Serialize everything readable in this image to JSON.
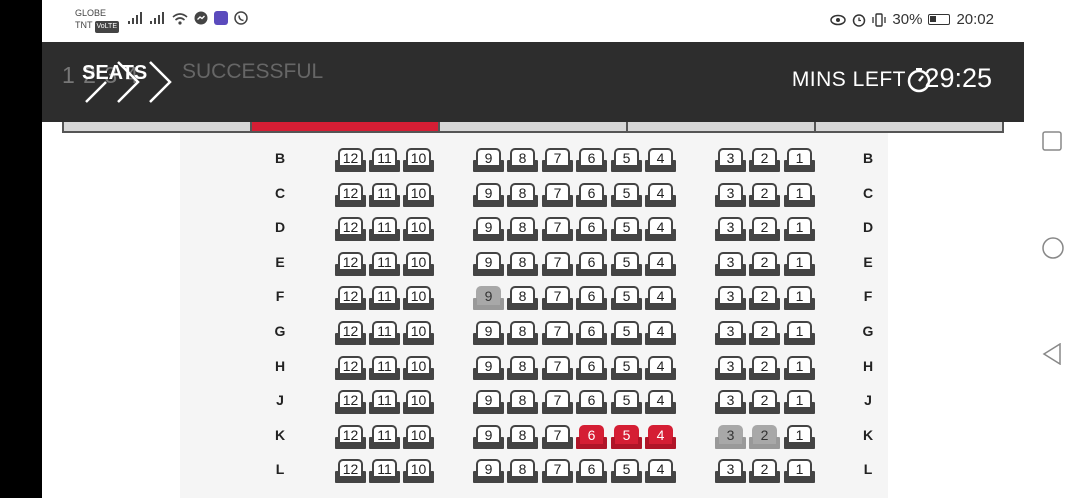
{
  "status_bar": {
    "carrier_line1": "GLOBE",
    "carrier_line2": "TNT",
    "volte": "VoLTE",
    "battery_percent": "30%",
    "battery_level": 0.3,
    "time": "20:02"
  },
  "header": {
    "steps": "1  2  3  4",
    "title": "SEATS",
    "ghost_text": "SUCCESSFUL",
    "timer_label": "MINS LEFT",
    "timer_value": "29:25"
  },
  "seat_columns": [
    "12",
    "11",
    "10",
    "9",
    "8",
    "7",
    "6",
    "5",
    "4",
    "3",
    "2",
    "1"
  ],
  "rows": [
    {
      "label": "B",
      "selected": [],
      "taken": []
    },
    {
      "label": "C",
      "selected": [],
      "taken": []
    },
    {
      "label": "D",
      "selected": [],
      "taken": []
    },
    {
      "label": "E",
      "selected": [],
      "taken": []
    },
    {
      "label": "F",
      "selected": [],
      "taken": [
        "9"
      ]
    },
    {
      "label": "G",
      "selected": [],
      "taken": []
    },
    {
      "label": "H",
      "selected": [],
      "taken": []
    },
    {
      "label": "J",
      "selected": [],
      "taken": []
    },
    {
      "label": "K",
      "selected": [
        "6",
        "5",
        "4"
      ],
      "taken": [
        "3",
        "2"
      ]
    },
    {
      "label": "L",
      "selected": [],
      "taken": []
    }
  ],
  "colors": {
    "header_bg": "#2d2d2d",
    "selected": "#d51e34",
    "taken": "#a8a8a8",
    "available_outline": "#444444"
  },
  "icons": {
    "timer": "stopwatch-icon",
    "nav_recent": "square-icon",
    "nav_home": "circle-icon",
    "nav_back": "triangle-back-icon"
  }
}
